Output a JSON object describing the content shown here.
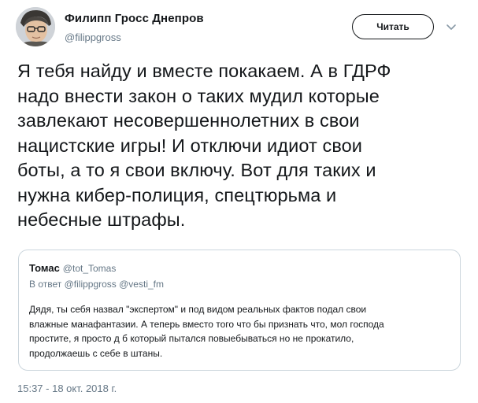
{
  "tweet": {
    "author": {
      "display_name": "Филипп Гросс Днепров",
      "handle": "@filippgross"
    },
    "follow_button_label": "Читать",
    "text": "Я тебя найду и вместе покакаем. А в ГДРФ\nнадо внести закон о таких мудил которые\nзавлекают несовершеннолетних в свои\nнацистские игры! И отключи идиот свои\nботы, а то я свои включу. Вот для таких и\nнужна кибер-полиция, спецтюрьма и\nнебесные штрафы.",
    "timestamp": "15:37 - 18 окт. 2018 г."
  },
  "quoted": {
    "name": "Томас",
    "handle": "@tot_Tomas",
    "reply_to": "В ответ @filippgross @vesti_fm",
    "text": "Дядя, ты себя назвал \"экспертом\" и под видом реальных фактов подал свои\nвлажные манафантазии. А теперь вместо того что бы признать что, мол господа\nпростите, я просто д     б который пытался повыебываться но не прокатило,\nпродолжаешь с        себе в штаны."
  }
}
